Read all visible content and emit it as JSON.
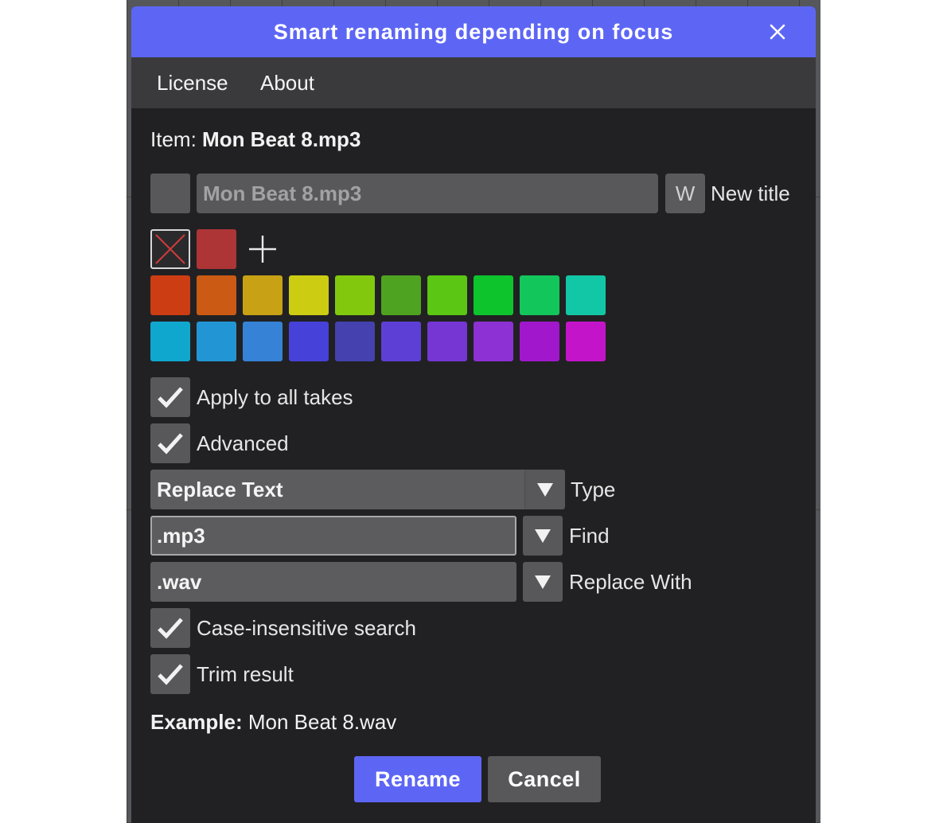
{
  "dialog": {
    "title": "Smart renaming depending on focus",
    "colors": {
      "titlebar": "#5d66f4",
      "background": "#212123",
      "menubar": "#3a3a3c",
      "primary_button": "#5d66f4"
    }
  },
  "menu": {
    "items": [
      "License",
      "About"
    ]
  },
  "item": {
    "label": "Item:",
    "name": "Mon Beat 8.mp3"
  },
  "title_row": {
    "value": "Mon Beat 8.mp3",
    "w_label": "W",
    "label": "New title"
  },
  "colors": {
    "no_color_icon": "no-color-icon",
    "current": "#ad3536",
    "add_icon": "plus-icon",
    "row1": [
      "#cc3d13",
      "#cb5a14",
      "#c8a214",
      "#cccc13",
      "#82c90e",
      "#4ea320",
      "#5bc614",
      "#0dc42d",
      "#13c65c",
      "#12c7a5"
    ],
    "row2": [
      "#10a7cf",
      "#2296d4",
      "#3682d6",
      "#4641d8",
      "#4541ae",
      "#5d3fd6",
      "#7536d3",
      "#8d30d4",
      "#a118cc",
      "#c414c9"
    ]
  },
  "options": {
    "apply_all_takes": {
      "label": "Apply to all takes",
      "checked": true
    },
    "advanced": {
      "label": "Advanced",
      "checked": true
    },
    "case_insensitive": {
      "label": "Case-insensitive search",
      "checked": true
    },
    "trim_result": {
      "label": "Trim result",
      "checked": true
    }
  },
  "advanced": {
    "type": {
      "value": "Replace Text",
      "label": "Type"
    },
    "find": {
      "value": ".mp3",
      "label": "Find"
    },
    "replace": {
      "value": ".wav",
      "label": "Replace With"
    }
  },
  "example": {
    "label": "Example:",
    "value": "Mon Beat 8.wav"
  },
  "buttons": {
    "rename": "Rename",
    "cancel": "Cancel"
  }
}
